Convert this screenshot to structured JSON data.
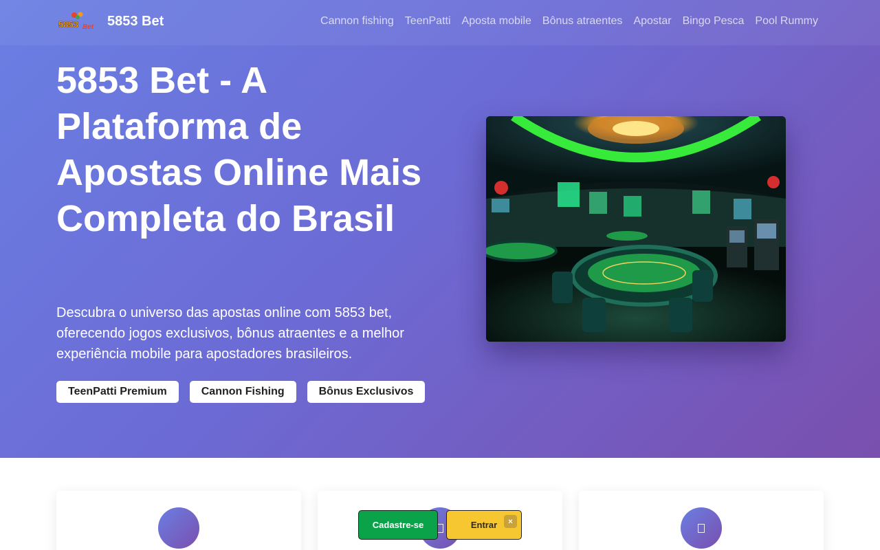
{
  "header": {
    "brand": "5853 Bet",
    "logo_text": "5853Bet",
    "nav": [
      {
        "label": "Cannon fishing"
      },
      {
        "label": "TeenPatti"
      },
      {
        "label": "Aposta mobile"
      },
      {
        "label": "Bônus atraentes"
      },
      {
        "label": "Apostar"
      },
      {
        "label": "Bingo Pesca"
      },
      {
        "label": "Pool Rummy"
      }
    ]
  },
  "hero": {
    "title": "5853 Bet - A Plataforma de Apostas Online Mais Completa do Brasil",
    "description": "Descubra o universo das apostas online com 5853 bet, oferecendo jogos exclusivos, bônus atraentes e a melhor experiência mobile para apostadores brasileiros.",
    "buttons": [
      {
        "label": "TeenPatti Premium"
      },
      {
        "label": "Cannon Fishing"
      },
      {
        "label": "Bônus Exclusivos"
      }
    ]
  },
  "features": {
    "cards": [
      {
        "icon": "feature-icon"
      },
      {
        "icon": "feature-icon"
      },
      {
        "icon": "feature-icon"
      }
    ]
  },
  "floating": {
    "signup_label": "Cadastre-se",
    "login_label": "Entrar",
    "close_symbol": "×"
  },
  "colors": {
    "hero_start": "#6a7fe3",
    "hero_end": "#7a4fae",
    "signup": "#0aa34a",
    "login": "#f7c731"
  }
}
